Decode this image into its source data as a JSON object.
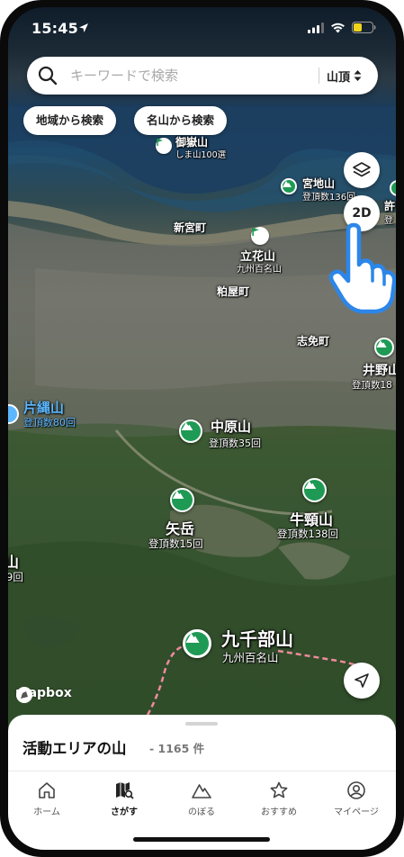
{
  "status_bar": {
    "time": "15:45"
  },
  "search": {
    "placeholder": "キーワードで検索",
    "filter_label": "山頂"
  },
  "chips": {
    "region": "地域から検索",
    "famous": "名山から検索"
  },
  "map_controls": {
    "layers_icon": "layers-icon",
    "mode_label": "2D",
    "locate_icon": "navigation-arrow-icon"
  },
  "places": {
    "shingu": "新宮町",
    "kasuya": "粕屋町",
    "shime": "志免町"
  },
  "mountains": {
    "mitaka": {
      "name": "御嶽山",
      "sub": "しま山100選"
    },
    "miyaji": {
      "name": "宮地山",
      "sub": "登頂数136回"
    },
    "tachibana": {
      "name": "立花山",
      "sub": "九州百名山"
    },
    "inokuma": {
      "name": "井野山",
      "sub": "登頂数18"
    },
    "katanawa": {
      "name": "片縄山",
      "sub": "登頂数80回"
    },
    "nakahara": {
      "name": "中原山",
      "sub": "登頂数35回"
    },
    "yadake": {
      "name": "矢岳",
      "sub": "登頂数15回"
    },
    "gozu": {
      "name": "牛頸山",
      "sub": "登頂数138回"
    },
    "kusenbu": {
      "name": "九千部山",
      "sub": "九州百名山"
    },
    "left_edge": {
      "name": "山",
      "sub": "9回"
    },
    "right_top": {
      "name": "許",
      "sub": "登"
    }
  },
  "attribution": {
    "brand": "mapbox"
  },
  "sheet": {
    "title": "活動エリアの山",
    "count": "- 1165 件"
  },
  "tabs": [
    {
      "label": "ホーム",
      "icon": "home-icon"
    },
    {
      "label": "さがす",
      "icon": "map-search-icon"
    },
    {
      "label": "のぼる",
      "icon": "mountain-icon"
    },
    {
      "label": "おすすめ",
      "icon": "star-icon"
    },
    {
      "label": "マイページ",
      "icon": "user-circle-icon"
    }
  ],
  "colors": {
    "pin_green": "#1f9a55",
    "route_pink": "#f08a9c",
    "blue_label": "#5bb7ff"
  }
}
